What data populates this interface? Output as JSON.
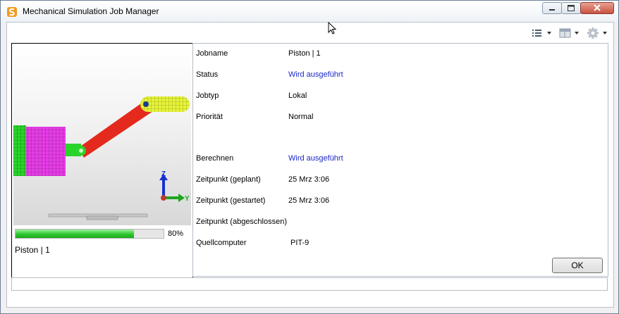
{
  "window": {
    "title": "Mechanical Simulation Job Manager"
  },
  "toolbar": {
    "list_view_icon": "list-view-icon",
    "layout_icon": "layout-icon",
    "settings_icon": "gear-icon"
  },
  "preview": {
    "axis_z": "Z",
    "axis_y": "Y",
    "progress_percent": 80,
    "progress_label": "80%",
    "job_caption": "Piston  |  1",
    "colors": {
      "magenta_part": "#e63ce6",
      "red_arm": "#e42a1c",
      "green_joint": "#29d42a",
      "yellow_part": "#e6f23a"
    }
  },
  "details": [
    {
      "label": "Jobname",
      "value": "Piston  |  1",
      "highlight": false
    },
    {
      "label": "Status",
      "value": "Wird ausgeführt",
      "highlight": true
    },
    {
      "label": "Jobtyp",
      "value": "Lokal",
      "highlight": false
    },
    {
      "label": "Priorität",
      "value": "Normal",
      "highlight": false
    },
    {
      "label": "Berechnen",
      "value": "Wird ausgeführt",
      "highlight": true
    },
    {
      "label": "Zeitpunkt (geplant)",
      "value": "25 Mrz 3:06",
      "highlight": false
    },
    {
      "label": "Zeitpunkt (gestartet)",
      "value": "25 Mrz 3:06",
      "highlight": false
    },
    {
      "label": "Zeitpunkt (abgeschlossen)",
      "value": "",
      "highlight": false
    },
    {
      "label": "Quellcomputer",
      "value": "PIT-9",
      "highlight": false
    }
  ],
  "buttons": {
    "ok_label": "OK"
  },
  "colors": {
    "status_blue": "#1a27c8",
    "progress_green": "#2ec52e"
  }
}
